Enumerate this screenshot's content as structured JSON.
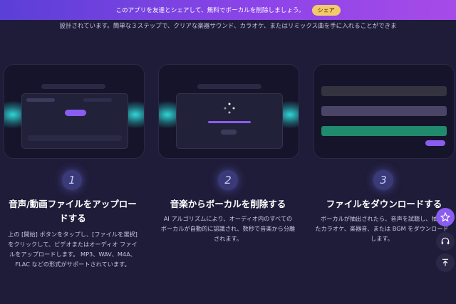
{
  "banner": {
    "text": "このアプリを友達とシェアして、無料でボーカルを削除しましょう。",
    "share_label": "シェア"
  },
  "intro": "設計されています。簡単な３ステップで、クリアな楽器サウンド、カラオケ、またはリミックス曲を手に入れることができま",
  "steps": [
    {
      "number": "1",
      "title_line1": "音声/動画ファイルをアップロー",
      "title_line2": "ドする",
      "desc": [
        "上の [開始] ボタンをタップし、[ファイルを選択]",
        "をクリックして、ビデオまたはオーディオ ファイ",
        "ルをアップロードします。 MP3、WAV、M4A、",
        "FLAC などの形式がサポートされています。"
      ]
    },
    {
      "number": "2",
      "title_line1": "音楽からボーカルを削除する",
      "desc": [
        "AI アルゴリズムにより、オーディオ内のすべての",
        "ボーカルが自動的に認識され、数秒で音楽から分離",
        "されます。"
      ]
    },
    {
      "number": "3",
      "title_line1": "ファイルをダウンロードする",
      "desc": [
        "ボーカルが抽出されたら、音声を試聴し、抽出",
        "たカラオケ、楽器音、または BGM をダウンロード",
        "します。"
      ]
    }
  ],
  "colors": {
    "background": "#1f1c3a",
    "accent": "#8a5cf0",
    "number_circle": "#3a3a78",
    "bar_green": "#1f8a6c",
    "banner_share": "#f4c96a"
  },
  "icons": [
    "star-icon",
    "headset-icon",
    "back-to-top-icon",
    "spinner-icon"
  ]
}
